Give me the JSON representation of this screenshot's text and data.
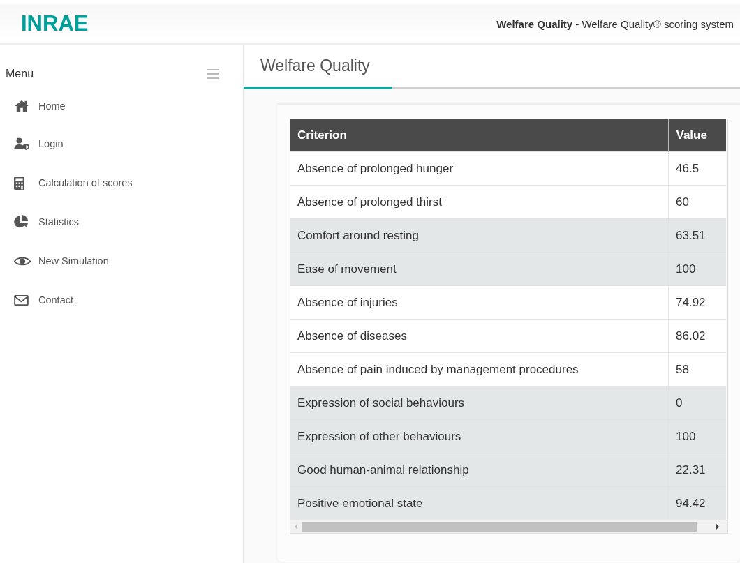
{
  "header": {
    "logo": "INRAE",
    "site_name": "Welfare Quality",
    "site_subtitle": " - Welfare Quality® scoring system"
  },
  "sidebar": {
    "title": "Menu",
    "items": [
      {
        "label": "Home"
      },
      {
        "label": "Login"
      },
      {
        "label": "Calculation of scores"
      },
      {
        "label": "Statistics"
      },
      {
        "label": "New Simulation"
      },
      {
        "label": "Contact"
      }
    ]
  },
  "page": {
    "title": "Welfare Quality",
    "progress": {
      "level": 0.3
    }
  },
  "table": {
    "columns": [
      "Criterion",
      "Value"
    ],
    "rows": [
      {
        "cells": [
          "Absence of prolonged hunger",
          "46.5"
        ],
        "shaded": false
      },
      {
        "cells": [
          "Absence of prolonged thirst",
          "60"
        ],
        "shaded": false
      },
      {
        "cells": [
          "Comfort around resting",
          "63.51"
        ],
        "shaded": true
      },
      {
        "cells": [
          "Ease of movement",
          "100"
        ],
        "shaded": true
      },
      {
        "cells": [
          "Absence of injuries",
          "74.92"
        ],
        "shaded": false
      },
      {
        "cells": [
          "Absence of diseases",
          "86.02"
        ],
        "shaded": false
      },
      {
        "cells": [
          "Absence of pain induced by management procedures",
          "58"
        ],
        "shaded": false
      },
      {
        "cells": [
          "Expression of social behaviours",
          "0"
        ],
        "shaded": true
      },
      {
        "cells": [
          "Expression of other behaviours",
          "100"
        ],
        "shaded": true
      },
      {
        "cells": [
          "Good human-animal relationship",
          "22.31"
        ],
        "shaded": true
      },
      {
        "cells": [
          "Positive emotional state",
          "94.42"
        ],
        "shaded": true
      }
    ]
  }
}
